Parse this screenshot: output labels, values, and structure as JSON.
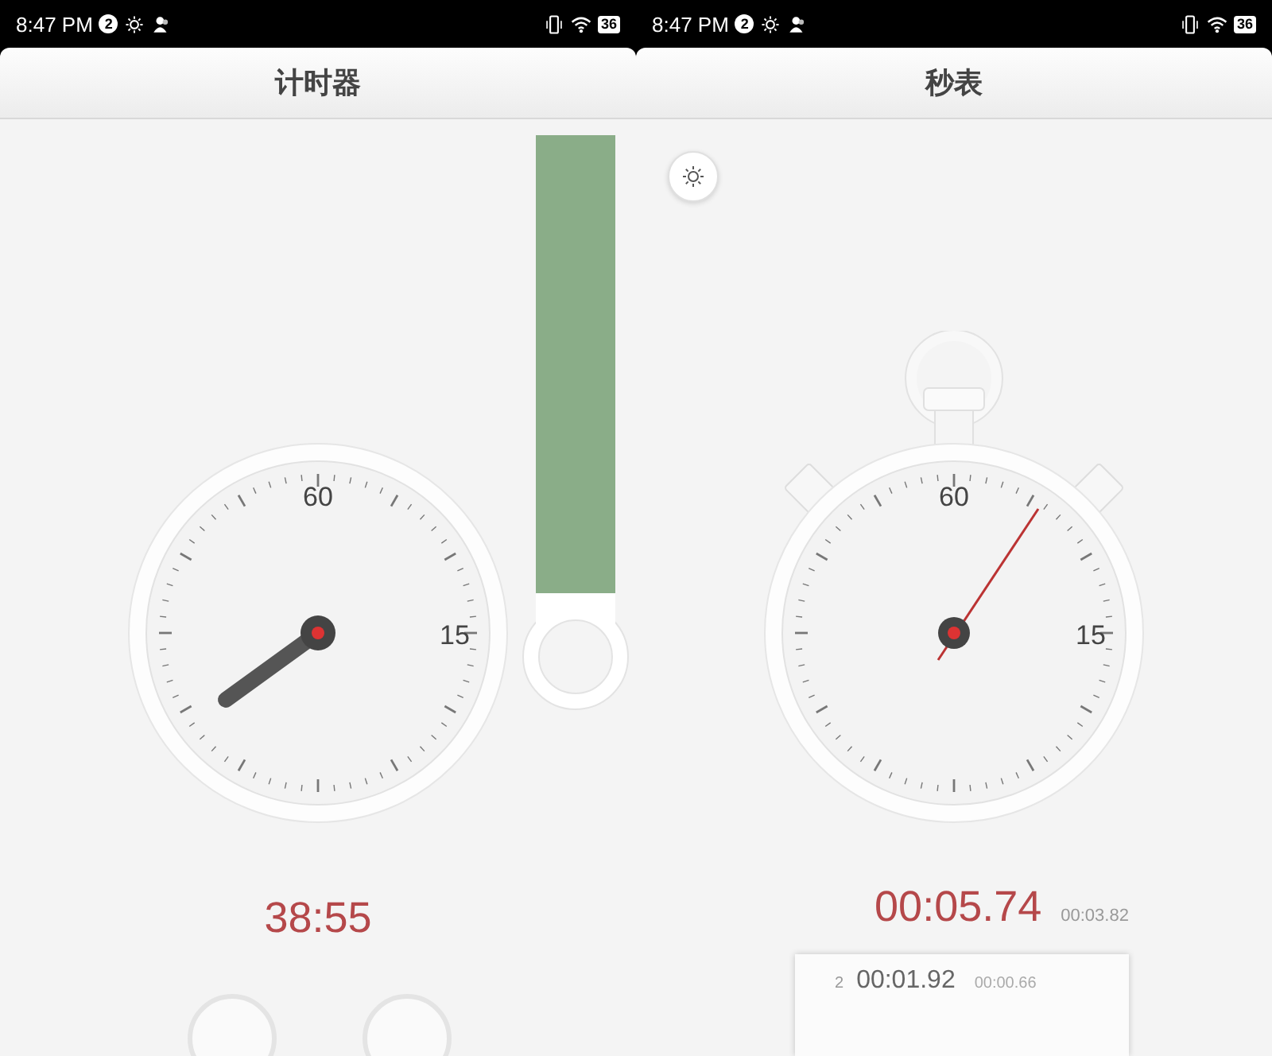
{
  "screens": [
    {
      "status_bar": {
        "time": "8:47 PM",
        "notification_count": "2",
        "battery": "36"
      },
      "title": "计时器",
      "kind": "timer",
      "dial_labels": [
        "60",
        "15"
      ],
      "reading": "38:55"
    },
    {
      "status_bar": {
        "time": "8:47 PM",
        "notification_count": "2",
        "battery": "36"
      },
      "title": "秒表",
      "kind": "stopwatch",
      "dial_labels": [
        "60",
        "15"
      ],
      "reading": "00:05.74",
      "split": "00:03.82",
      "laps": [
        {
          "number": "2",
          "time": "00:01.92",
          "split": "00:00.66"
        }
      ]
    }
  ]
}
